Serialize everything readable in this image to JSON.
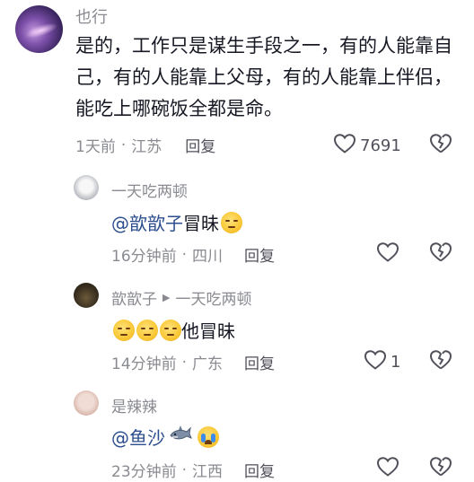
{
  "main_comment": {
    "username": "也行",
    "text": "是的，工作只是谋生手段之一，有的人能靠自己，有的人能靠上父母，有的人能靠上伴侣，能吃上哪碗饭全都是命。",
    "time": "1天前",
    "location": "江苏",
    "reply_label": "回复",
    "like_count": "7691"
  },
  "replies": [
    {
      "username": "一天吃两顿",
      "reply_to": "",
      "mention": "@歆歆子",
      "text": " 冒昧",
      "emoji": "awkward-emoji",
      "time": "16分钟前",
      "location": "四川",
      "reply_label": "回复",
      "like_count": ""
    },
    {
      "username": "歆歆子",
      "reply_to": "一天吃两顿",
      "mention": "",
      "text": "他冒昧",
      "emoji": "awkward-emoji",
      "time": "14分钟前",
      "location": "广东",
      "reply_label": "回复",
      "like_count": "1"
    },
    {
      "username": "是辣辣",
      "reply_to": "",
      "mention": "@鱼沙",
      "text": "",
      "emoji": "shark-and-crying-emoji",
      "time": "23分钟前",
      "location": "江西",
      "reply_label": "回复",
      "like_count": ""
    }
  ],
  "meta_separator": "·",
  "colors": {
    "text": "#161823",
    "secondary": "#8a8b91",
    "mention": "#2c4d8e"
  }
}
